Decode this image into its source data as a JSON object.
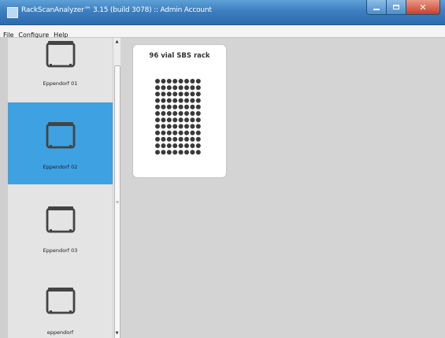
{
  "window": {
    "title": "RackScanAnalyzer™ 3.15 (build 3078)  :: Admin Account",
    "controls": {
      "minimize_icon": "minimize-icon",
      "maximize_icon": "maximize-icon",
      "close_icon": "close-icon"
    }
  },
  "menu": {
    "items": [
      {
        "label": "File"
      },
      {
        "label": "Configure"
      },
      {
        "label": "Help"
      }
    ]
  },
  "sidebar": {
    "selected_index": 1,
    "items": [
      {
        "label": "Eppendorf 01",
        "icon": "rack-icon"
      },
      {
        "label": "Eppendorf 02",
        "icon": "rack-icon"
      },
      {
        "label": "Eppendorf 03",
        "icon": "rack-icon"
      },
      {
        "label": "eppendorf",
        "icon": "rack-icon"
      }
    ]
  },
  "main": {
    "rack_card": {
      "title": "96 vial SBS rack",
      "vials": {
        "rows": 12,
        "columns": 8
      }
    }
  },
  "colors": {
    "selection": "#3ea1e2",
    "titlebar": "#3d7fc0",
    "close_button": "#c7402a"
  }
}
